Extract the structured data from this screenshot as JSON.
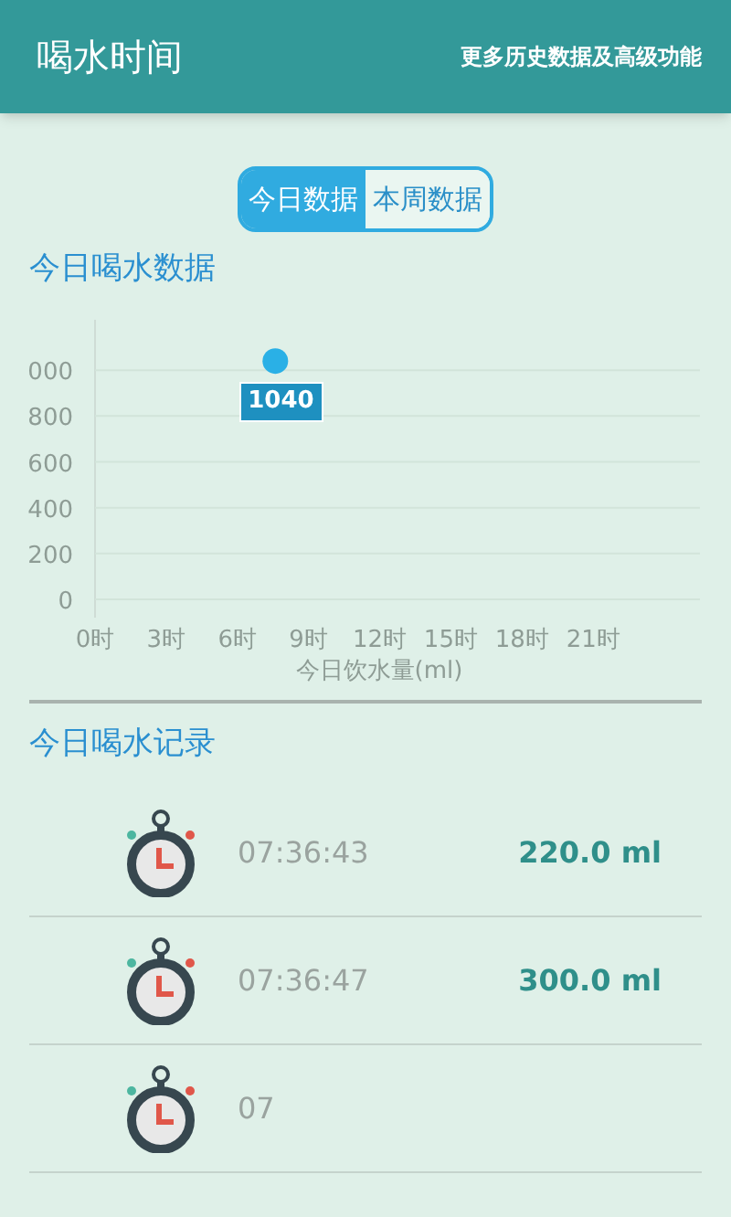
{
  "header": {
    "title": "喝水时间",
    "action": "更多历史数据及高级功能"
  },
  "tabs": [
    {
      "label": "今日数据",
      "selected": true
    },
    {
      "label": "本周数据",
      "selected": false
    }
  ],
  "chart_section": {
    "heading": "今日喝水数据",
    "cut_top_tick_label": "000",
    "chart_data": {
      "type": "scatter",
      "xlabel": "今日饮水量(ml)",
      "x": [
        7.6
      ],
      "series": [
        {
          "color": "#2ab0e6",
          "values": [
            1040
          ]
        }
      ],
      "xlim": [
        0,
        25.5
      ],
      "ylim": [
        0,
        1220
      ],
      "grid": true,
      "xticks": [
        {
          "value": 0,
          "label": "0时"
        },
        {
          "value": 3,
          "label": "3时"
        },
        {
          "value": 6,
          "label": "6时"
        },
        {
          "value": 9,
          "label": "9时"
        },
        {
          "value": 12,
          "label": "12时"
        },
        {
          "value": 15,
          "label": "15时"
        },
        {
          "value": 18,
          "label": "18时"
        },
        {
          "value": 21,
          "label": "21时"
        }
      ],
      "yticks": [
        {
          "value": 0,
          "label": "0"
        },
        {
          "value": 200,
          "label": "200"
        },
        {
          "value": 400,
          "label": "400"
        },
        {
          "value": 600,
          "label": "600"
        },
        {
          "value": 800,
          "label": "800"
        }
      ],
      "value_labels": [
        "1040"
      ]
    }
  },
  "records_section": {
    "heading": "今日喝水记录",
    "records": [
      {
        "time": "07:36:43",
        "amount": "220.0 ml"
      },
      {
        "time": "07:36:47",
        "amount": "300.0 ml"
      },
      {
        "time": "07"
      }
    ]
  }
}
